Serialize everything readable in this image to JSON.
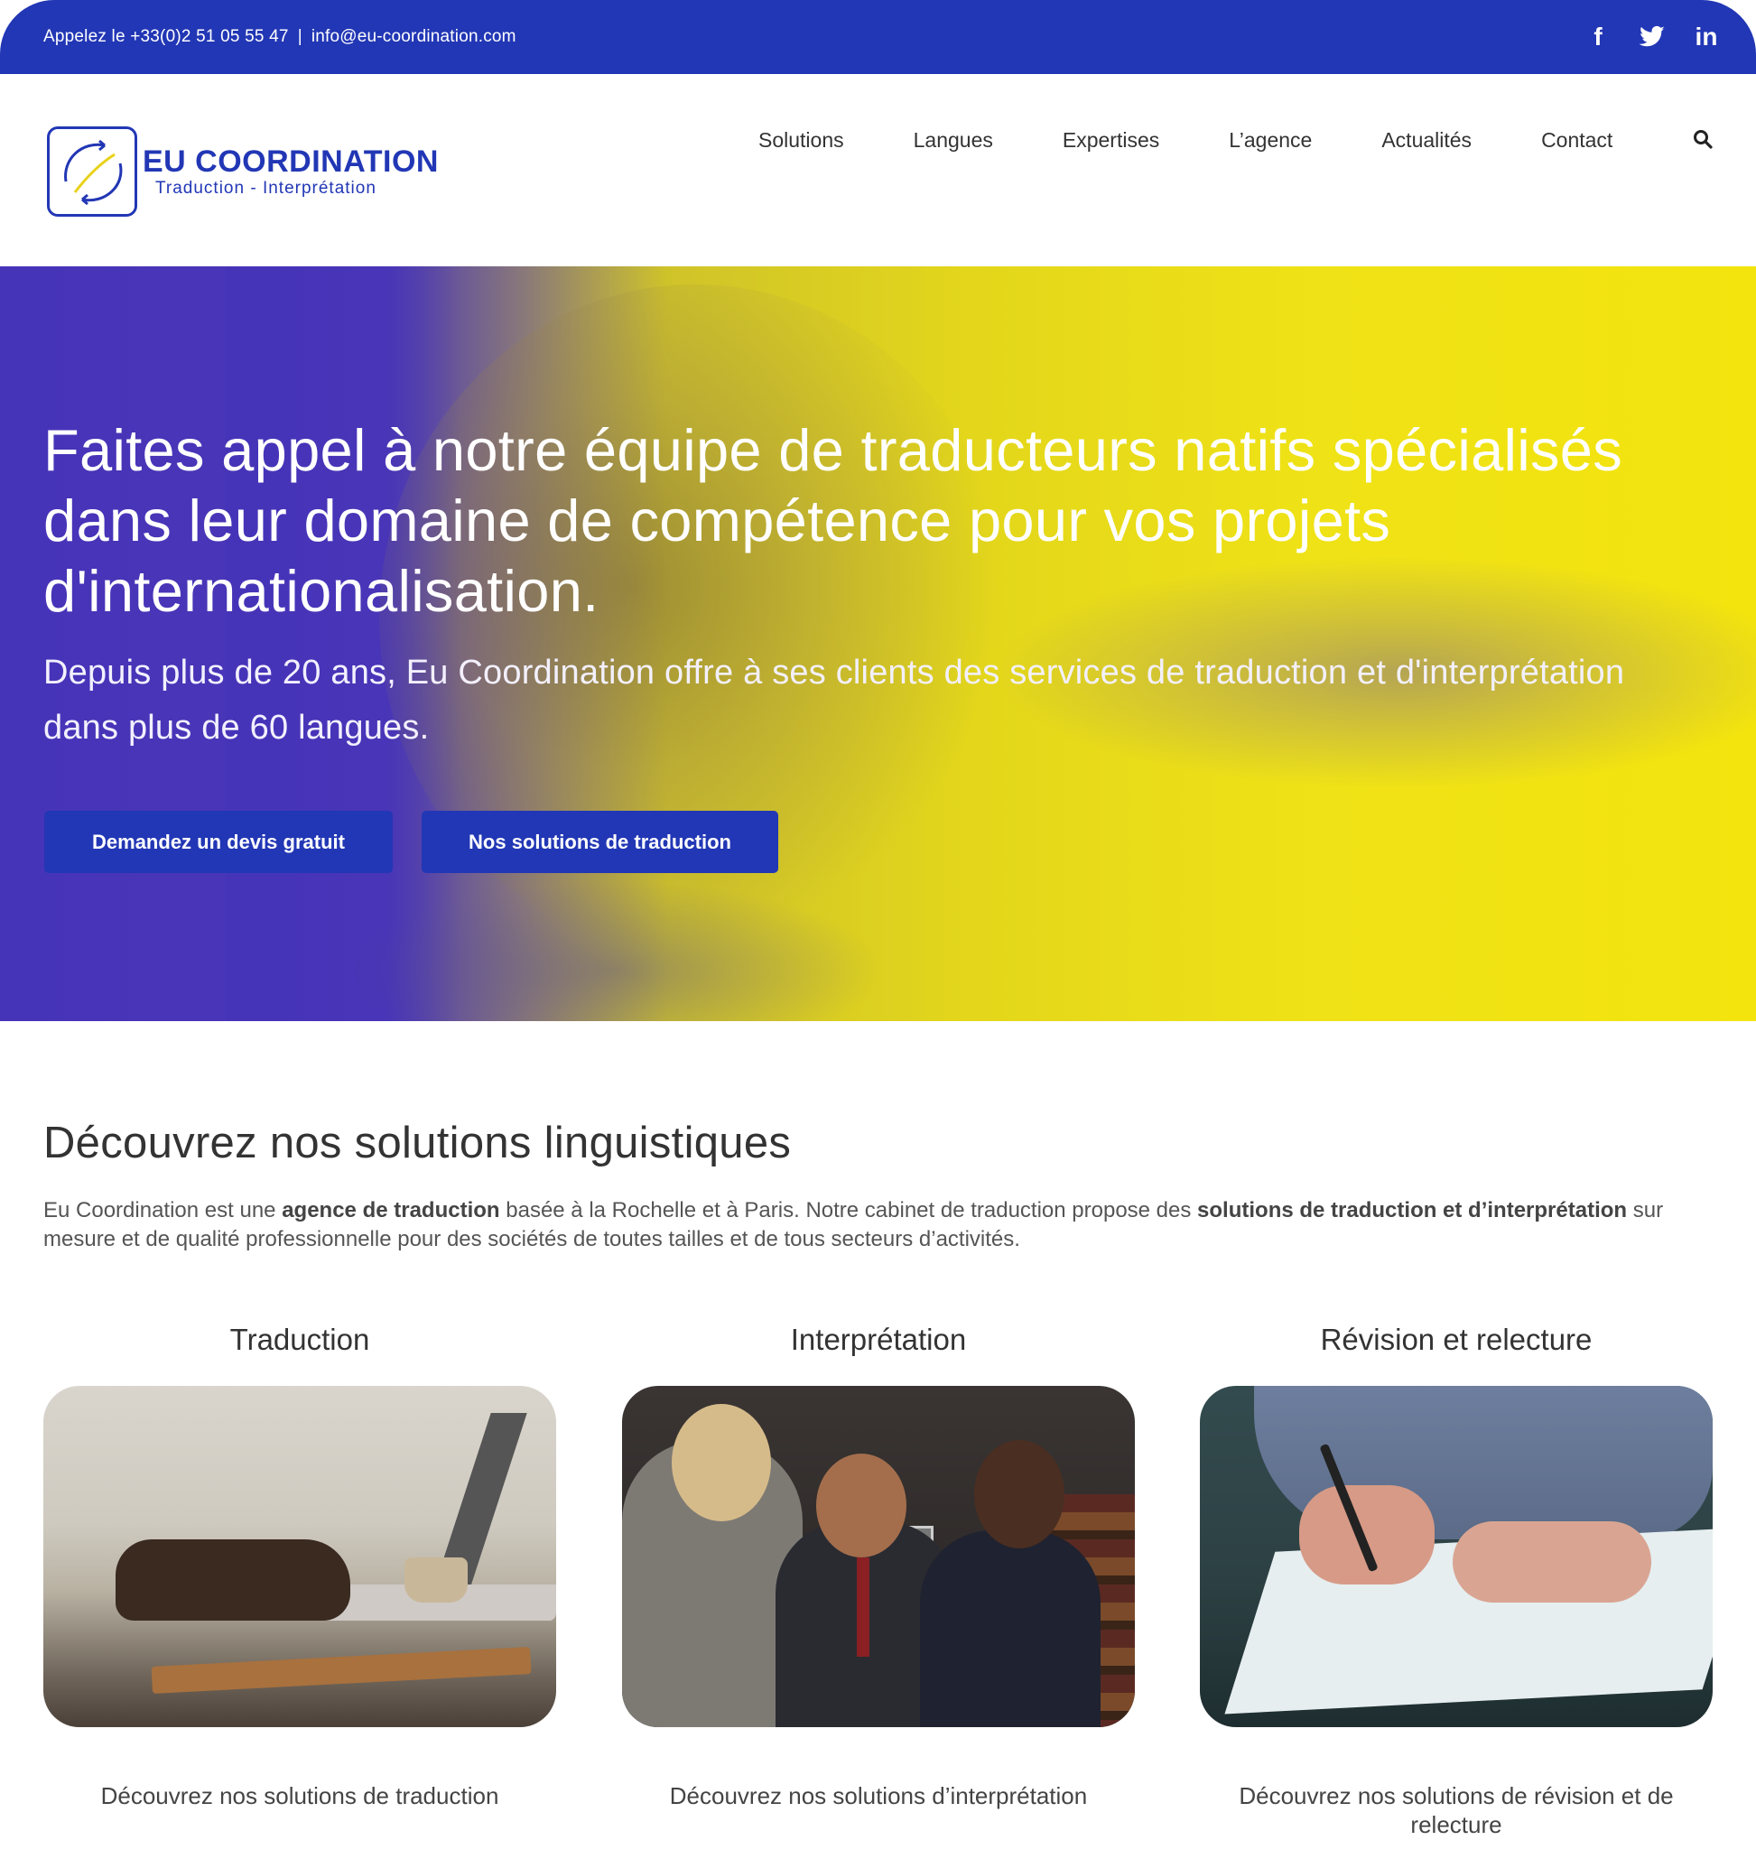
{
  "topbar": {
    "phone": "Appelez le +33(0)2 51 05 55 47",
    "separator": "|",
    "email": "info@eu-coordination.com",
    "social": [
      {
        "icon": "facebook-icon",
        "glyph": "f"
      },
      {
        "icon": "twitter-icon",
        "glyph": "🐦"
      },
      {
        "icon": "linkedin-icon",
        "glyph": "in"
      }
    ],
    "background": "#2237b5"
  },
  "logo": {
    "title": "EU COORDINATION",
    "subtitle": "Traduction - Interprétation"
  },
  "nav": {
    "items": [
      "Solutions",
      "Langues",
      "Expertises",
      "L’agence",
      "Actualités",
      "Contact"
    ],
    "search_icon": "search-icon"
  },
  "hero": {
    "heading": "Faites appel à notre équipe de traducteurs natifs spécialisés dans leur domaine de compétence pour vos projets d'internationalisation.",
    "subheading": "Depuis plus de 20 ans, Eu Coordination offre à ses clients des services de traduction et d'interprétation dans plus de 60 langues.",
    "cta_quote": "Demandez un devis gratuit",
    "cta_solutions": "Nos solutions de traduction",
    "accent_blue": "#4634b8",
    "accent_yellow": "#f3e40e"
  },
  "solutions": {
    "title": "Découvrez nos solutions linguistiques",
    "intro_parts": {
      "p1": "Eu Coordination est une ",
      "b1": "agence de traduction",
      "p2": " basée à la Rochelle et à Paris. Notre cabinet de traduction propose des ",
      "b2": "solutions de traduction et d’interprétation",
      "p3": " sur mesure et de qualité professionnelle pour des sociétés de toutes tailles et de tous secteurs d’activités."
    },
    "cards": [
      {
        "title": "Traduction",
        "desc": "Découvrez nos solutions de traduction"
      },
      {
        "title": "Interprétation",
        "desc": "Découvrez nos solutions d’interprétation"
      },
      {
        "title": "Révision et relecture",
        "desc": "Découvrez nos solutions de révision et de relecture"
      }
    ]
  }
}
